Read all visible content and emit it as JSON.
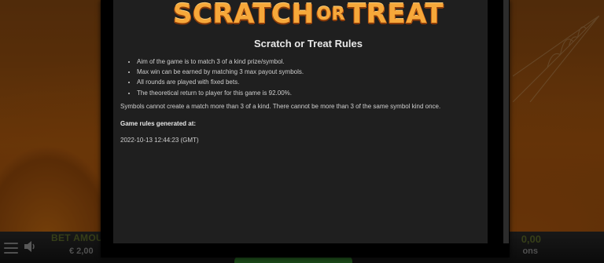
{
  "game": {
    "logo_text_main": "SCRATCH",
    "logo_text_or": "OR",
    "logo_text_end": "TREAT"
  },
  "rules": {
    "title": "Scratch or Treat Rules",
    "bullets": [
      "Aim of the game is to match 3 of a kind prize/symbol.",
      "Max win can be earned by matching 3 max payout symbols.",
      "All rounds are played with fixed bets.",
      "The theoretical return to player for this game is 92.00%."
    ],
    "note": "Symbols cannot create a match more than 3 of a kind. There cannot be more than 3 of the same symbol kind once.",
    "generated_label": "Game rules generated at:",
    "generated_date": "2022-10-13 12:44:23 (GMT)"
  },
  "bottom_bar": {
    "bet_label": "BET AMOU",
    "bet_value": "€ 2,00",
    "right_value": "0,00",
    "right_label": "ons",
    "icons": [
      "menu-icon",
      "sound-icon"
    ]
  },
  "colors": {
    "modal_bg": "#1f1f1f",
    "logo_orange": "#f6a83a",
    "bet_green": "#5d6b2a"
  }
}
